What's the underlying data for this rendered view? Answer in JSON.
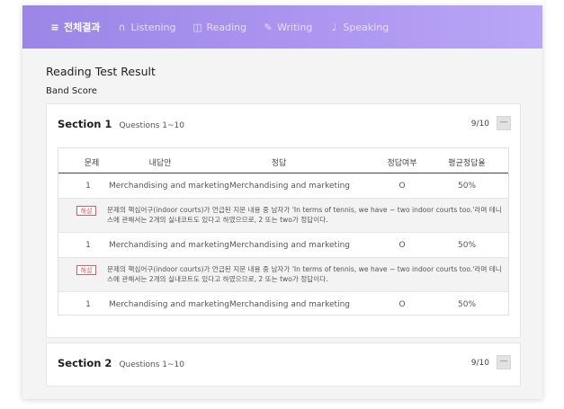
{
  "tabs": [
    {
      "label": "전체결과",
      "icon": "menu-icon",
      "glyph": "≡",
      "active": true
    },
    {
      "label": "Listening",
      "icon": "headphones-icon",
      "glyph": "∩",
      "active": false
    },
    {
      "label": "Reading",
      "icon": "book-icon",
      "glyph": "◫",
      "active": false
    },
    {
      "label": "Writing",
      "icon": "pencil-icon",
      "glyph": "✎",
      "active": false
    },
    {
      "label": "Speaking",
      "icon": "microphone-icon",
      "glyph": "♩",
      "active": false
    }
  ],
  "page": {
    "title": "Reading Test Result",
    "subtitle": "Band Score"
  },
  "sections": [
    {
      "name": "Section 1",
      "questions": "Questions 1~10",
      "score": "9/10",
      "toggle": "—",
      "headers": [
        "문제",
        "내답안",
        "정답",
        "정답여부",
        "평균정답율"
      ],
      "rows": [
        {
          "num": "1",
          "mine": "Merchandising and marketing",
          "answer": "Merchandising and marketing",
          "result": "O",
          "avg": "50%"
        },
        {
          "num": "1",
          "mine": "Merchandising and marketing",
          "answer": "Merchandising and marketing",
          "result": "O",
          "avg": "50%"
        },
        {
          "num": "1",
          "mine": "Merchandising and marketing",
          "answer": "Merchandising and marketing",
          "result": "O",
          "avg": "50%"
        }
      ],
      "explanations": [
        {
          "badge": "해설",
          "text": "문제의 핵심어구(indoor courts)가 언급된 지문 내용 중 남자가 'In terms of tennis, we have ~ two indoor courts too.'라며 테니스에 관해서는 2개의 실내코트도 있다고 하였으므로, 2 또는 two가 정답이다."
        },
        {
          "badge": "해설",
          "text": "문제의 핵심어구(indoor courts)가 언급된 지문 내용 중 남자가 'In terms of tennis, we have ~ two indoor courts too.'라며 테니스에 관해서는 2개의 실내코트도 있다고 하였으므로, 2 또는 two가 정답이다."
        }
      ]
    },
    {
      "name": "Section 2",
      "questions": "Questions 1~10",
      "score": "9/10",
      "toggle": "—"
    }
  ],
  "colors": {
    "tabbar_start": "#9b86e6",
    "tabbar_end": "#b9a6f6",
    "badge_red": "#e35a5a"
  }
}
